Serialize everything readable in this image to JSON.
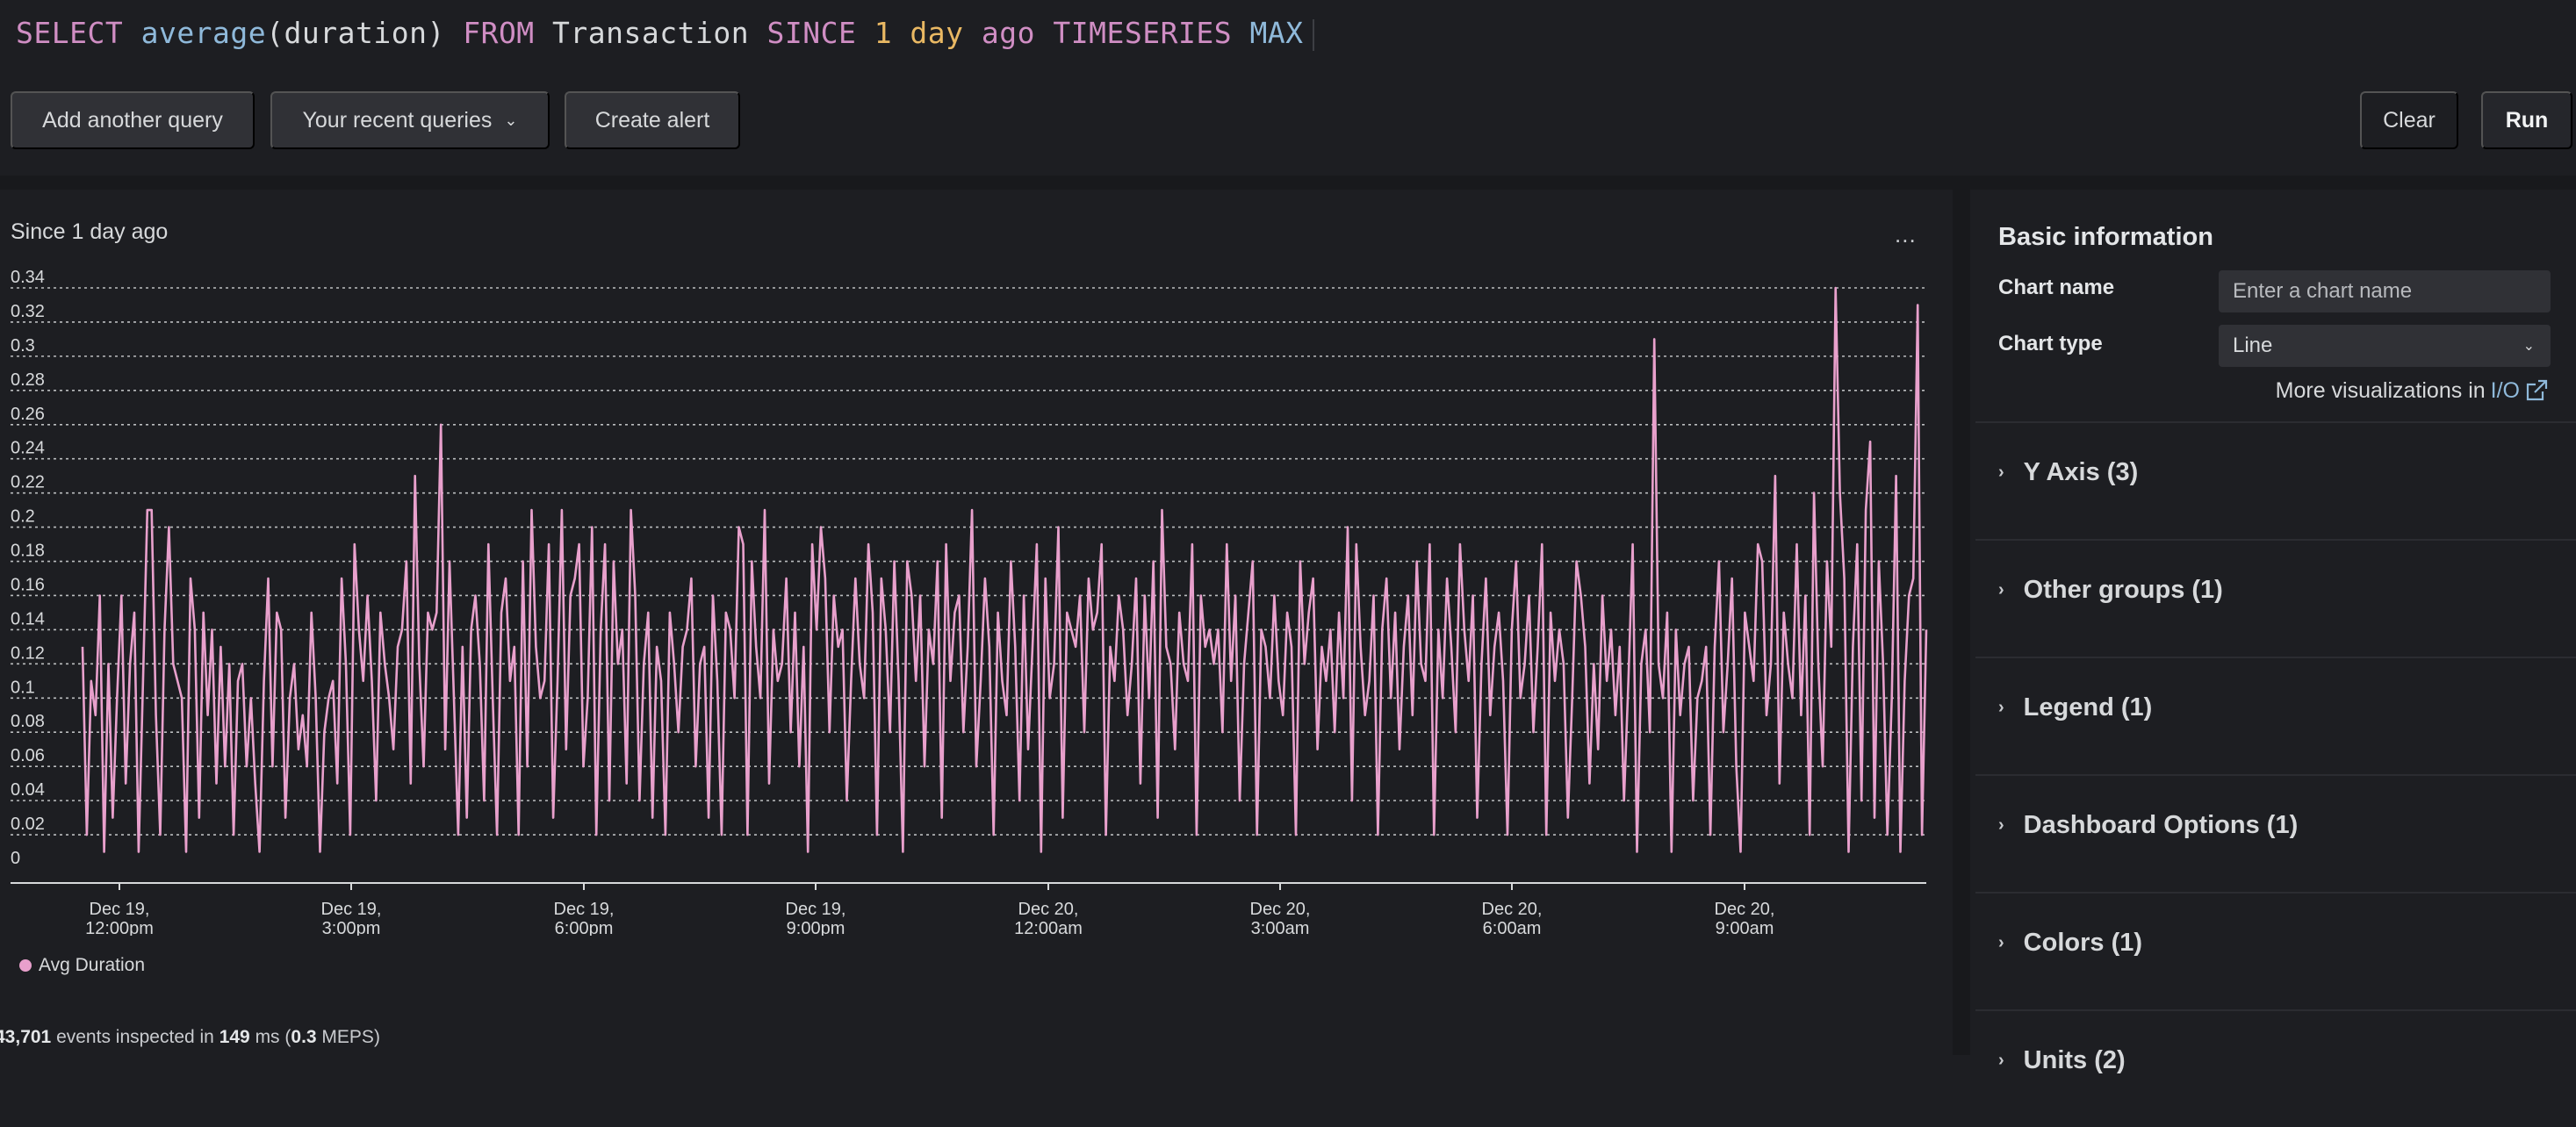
{
  "query": {
    "tokens": [
      {
        "text": "SELECT ",
        "kind": "kw"
      },
      {
        "text": "average",
        "kind": "fn"
      },
      {
        "text": "(duration) ",
        "kind": "plain"
      },
      {
        "text": "FROM ",
        "kind": "kw"
      },
      {
        "text": "Transaction ",
        "kind": "plain"
      },
      {
        "text": "SINCE ",
        "kind": "kw"
      },
      {
        "text": "1 day ",
        "kind": "num"
      },
      {
        "text": "ago ",
        "kind": "kw"
      },
      {
        "text": "TIMESERIES ",
        "kind": "kw"
      },
      {
        "text": "MAX",
        "kind": "fn"
      }
    ]
  },
  "toolbar": {
    "add_query": "Add another query",
    "recent_queries": "Your recent queries",
    "create_alert": "Create alert",
    "clear": "Clear",
    "run": "Run"
  },
  "chart": {
    "subtitle": "Since 1 day ago",
    "menu": "...",
    "legend_label": "Avg Duration",
    "footer": {
      "events": "43,701",
      "events_text": " events inspected in ",
      "ms": "149",
      "ms_text": " ms (",
      "meps": "0.3",
      "meps_text": " MEPS)"
    }
  },
  "chart_data": {
    "type": "line",
    "title": "",
    "xlabel": "",
    "ylabel": "",
    "ylim": [
      0,
      0.34
    ],
    "yticks": [
      0,
      0.02,
      0.04,
      0.06,
      0.08,
      0.1,
      0.12,
      0.14,
      0.16,
      0.18,
      0.2,
      0.22,
      0.24,
      0.26,
      0.28,
      0.3,
      0.32,
      0.34
    ],
    "grid": true,
    "xticks": [
      {
        "lines": [
          "Dec 19,",
          "12:00pm"
        ]
      },
      {
        "lines": [
          "Dec 19,",
          "3:00pm"
        ]
      },
      {
        "lines": [
          "Dec 19,",
          "6:00pm"
        ]
      },
      {
        "lines": [
          "Dec 19,",
          "9:00pm"
        ]
      },
      {
        "lines": [
          "Dec 20,",
          "12:00am"
        ]
      },
      {
        "lines": [
          "Dec 20,",
          "3:00am"
        ]
      },
      {
        "lines": [
          "Dec 20,",
          "6:00am"
        ]
      },
      {
        "lines": [
          "Dec 20,",
          "9:00am"
        ]
      }
    ],
    "x_range": [
      "Dec 19, 11:00am",
      "Dec 20, 11:00am"
    ],
    "legend_position": "bottom-left",
    "series": [
      {
        "name": "Avg Duration",
        "color": "#e8a0cc",
        "values": [
          0.13,
          0.02,
          0.11,
          0.09,
          0.16,
          0.01,
          0.12,
          0.03,
          0.1,
          0.16,
          0.05,
          0.12,
          0.15,
          0.01,
          0.11,
          0.21,
          0.21,
          0.09,
          0.02,
          0.14,
          0.2,
          0.12,
          0.11,
          0.1,
          0.01,
          0.17,
          0.14,
          0.03,
          0.15,
          0.09,
          0.14,
          0.05,
          0.13,
          0.06,
          0.12,
          0.02,
          0.11,
          0.12,
          0.06,
          0.1,
          0.05,
          0.01,
          0.11,
          0.17,
          0.06,
          0.15,
          0.14,
          0.03,
          0.1,
          0.12,
          0.07,
          0.09,
          0.06,
          0.15,
          0.1,
          0.01,
          0.08,
          0.1,
          0.11,
          0.05,
          0.17,
          0.12,
          0.02,
          0.19,
          0.14,
          0.11,
          0.16,
          0.11,
          0.04,
          0.15,
          0.12,
          0.1,
          0.07,
          0.13,
          0.14,
          0.18,
          0.05,
          0.23,
          0.12,
          0.06,
          0.15,
          0.14,
          0.15,
          0.26,
          0.07,
          0.18,
          0.1,
          0.02,
          0.13,
          0.03,
          0.14,
          0.16,
          0.12,
          0.04,
          0.19,
          0.1,
          0.02,
          0.15,
          0.17,
          0.11,
          0.13,
          0.02,
          0.18,
          0.06,
          0.21,
          0.13,
          0.1,
          0.11,
          0.19,
          0.03,
          0.11,
          0.21,
          0.07,
          0.16,
          0.17,
          0.19,
          0.06,
          0.1,
          0.2,
          0.02,
          0.14,
          0.19,
          0.04,
          0.18,
          0.12,
          0.14,
          0.05,
          0.21,
          0.16,
          0.04,
          0.12,
          0.15,
          0.03,
          0.13,
          0.11,
          0.02,
          0.15,
          0.12,
          0.08,
          0.13,
          0.14,
          0.17,
          0.06,
          0.12,
          0.13,
          0.03,
          0.16,
          0.11,
          0.02,
          0.15,
          0.14,
          0.1,
          0.2,
          0.19,
          0.02,
          0.18,
          0.13,
          0.1,
          0.21,
          0.05,
          0.14,
          0.11,
          0.12,
          0.17,
          0.08,
          0.15,
          0.06,
          0.13,
          0.01,
          0.19,
          0.14,
          0.2,
          0.17,
          0.08,
          0.16,
          0.13,
          0.14,
          0.04,
          0.11,
          0.17,
          0.12,
          0.1,
          0.19,
          0.15,
          0.02,
          0.17,
          0.14,
          0.08,
          0.18,
          0.11,
          0.01,
          0.18,
          0.16,
          0.11,
          0.16,
          0.06,
          0.14,
          0.12,
          0.18,
          0.03,
          0.19,
          0.11,
          0.15,
          0.16,
          0.08,
          0.13,
          0.21,
          0.06,
          0.11,
          0.17,
          0.13,
          0.02,
          0.15,
          0.11,
          0.09,
          0.18,
          0.13,
          0.04,
          0.16,
          0.07,
          0.13,
          0.19,
          0.01,
          0.17,
          0.1,
          0.12,
          0.2,
          0.03,
          0.15,
          0.14,
          0.13,
          0.16,
          0.08,
          0.17,
          0.14,
          0.15,
          0.19,
          0.02,
          0.13,
          0.11,
          0.16,
          0.14,
          0.09,
          0.12,
          0.17,
          0.05,
          0.16,
          0.1,
          0.18,
          0.03,
          0.21,
          0.13,
          0.12,
          0.07,
          0.15,
          0.12,
          0.11,
          0.19,
          0.02,
          0.16,
          0.13,
          0.14,
          0.12,
          0.14,
          0.08,
          0.19,
          0.11,
          0.16,
          0.04,
          0.12,
          0.15,
          0.18,
          0.02,
          0.14,
          0.13,
          0.1,
          0.16,
          0.11,
          0.09,
          0.15,
          0.13,
          0.02,
          0.18,
          0.12,
          0.15,
          0.17,
          0.07,
          0.13,
          0.11,
          0.14,
          0.08,
          0.15,
          0.1,
          0.2,
          0.04,
          0.19,
          0.13,
          0.09,
          0.11,
          0.16,
          0.02,
          0.14,
          0.17,
          0.1,
          0.15,
          0.07,
          0.13,
          0.16,
          0.09,
          0.18,
          0.12,
          0.11,
          0.19,
          0.02,
          0.14,
          0.1,
          0.17,
          0.13,
          0.08,
          0.19,
          0.14,
          0.11,
          0.16,
          0.03,
          0.12,
          0.17,
          0.09,
          0.13,
          0.15,
          0.11,
          0.02,
          0.14,
          0.18,
          0.1,
          0.12,
          0.16,
          0.08,
          0.13,
          0.19,
          0.02,
          0.15,
          0.11,
          0.14,
          0.12,
          0.03,
          0.1,
          0.18,
          0.16,
          0.13,
          0.05,
          0.12,
          0.07,
          0.16,
          0.11,
          0.14,
          0.09,
          0.13,
          0.04,
          0.11,
          0.19,
          0.01,
          0.12,
          0.14,
          0.08,
          0.31,
          0.12,
          0.1,
          0.15,
          0.01,
          0.14,
          0.09,
          0.12,
          0.13,
          0.04,
          0.1,
          0.11,
          0.13,
          0.02,
          0.13,
          0.18,
          0.08,
          0.12,
          0.17,
          0.06,
          0.01,
          0.15,
          0.13,
          0.11,
          0.19,
          0.18,
          0.09,
          0.12,
          0.23,
          0.05,
          0.15,
          0.12,
          0.1,
          0.19,
          0.09,
          0.16,
          0.02,
          0.22,
          0.12,
          0.06,
          0.18,
          0.13,
          0.34,
          0.22,
          0.17,
          0.01,
          0.13,
          0.19,
          0.04,
          0.21,
          0.25,
          0.03,
          0.18,
          0.12,
          0.02,
          0.1,
          0.23,
          0.01,
          0.11,
          0.16,
          0.17,
          0.33,
          0.02,
          0.14
        ]
      }
    ]
  },
  "side_panel": {
    "basic_title": "Basic information",
    "chart_name_label": "Chart name",
    "chart_name_placeholder": "Enter a chart name",
    "chart_type_label": "Chart type",
    "chart_type_value": "Line",
    "more_viz_text": "More visualizations in",
    "more_viz_link": "I/O",
    "sections": [
      {
        "label": "Y Axis (3)"
      },
      {
        "label": "Other groups (1)"
      },
      {
        "label": "Legend (1)"
      },
      {
        "label": "Dashboard Options (1)"
      },
      {
        "label": "Colors (1)"
      },
      {
        "label": "Units (2)"
      }
    ]
  },
  "icons": {
    "chevron_down": "chevron-down-icon",
    "chevron_right": "chevron-right-icon",
    "external_link": "external-link-icon",
    "more_menu": "more-horizontal-icon"
  }
}
